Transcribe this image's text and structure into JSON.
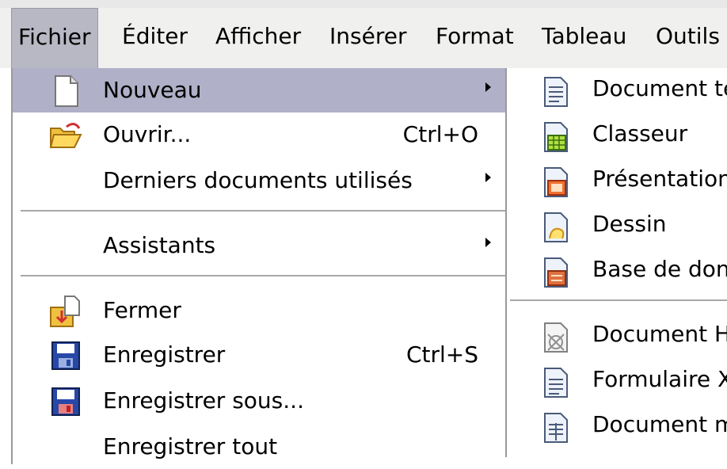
{
  "menubar": {
    "items": [
      {
        "label": "Fichier"
      },
      {
        "label": "Éditer"
      },
      {
        "label": "Afficher"
      },
      {
        "label": "Insérer"
      },
      {
        "label": "Format"
      },
      {
        "label": "Tableau"
      },
      {
        "label": "Outils"
      }
    ],
    "active": "Fichier"
  },
  "file_menu": {
    "items": [
      {
        "label": "Nouveau",
        "submenu": true,
        "highlighted": true,
        "icon": "new-document-icon"
      },
      {
        "label": "Ouvrir...",
        "shortcut": "Ctrl+O",
        "icon": "open-folder-icon"
      },
      {
        "label": "Derniers documents utilisés",
        "submenu": true
      },
      {
        "label": "Assistants",
        "submenu": true
      },
      {
        "label": "Fermer",
        "icon": "close-document-icon"
      },
      {
        "label": "Enregistrer",
        "shortcut": "Ctrl+S",
        "icon": "save-icon"
      },
      {
        "label": "Enregistrer sous...",
        "icon": "save-as-icon"
      },
      {
        "label": "Enregistrer tout"
      }
    ]
  },
  "new_submenu": {
    "items": [
      {
        "label": "Document te",
        "icon": "text-document-icon"
      },
      {
        "label": "Classeur",
        "icon": "spreadsheet-icon"
      },
      {
        "label": "Présentation",
        "icon": "presentation-icon"
      },
      {
        "label": "Dessin",
        "icon": "drawing-icon"
      },
      {
        "label": "Base de don",
        "icon": "database-icon"
      },
      {
        "label": "Document H",
        "icon": "html-document-icon"
      },
      {
        "label": "Formulaire X",
        "icon": "xml-form-icon"
      },
      {
        "label": "Document m",
        "icon": "master-document-icon"
      }
    ]
  },
  "colors": {
    "menubar_bg": "#f0f0ee",
    "highlight": "#b0b0c8",
    "active_menu": "#b8b8c4"
  }
}
